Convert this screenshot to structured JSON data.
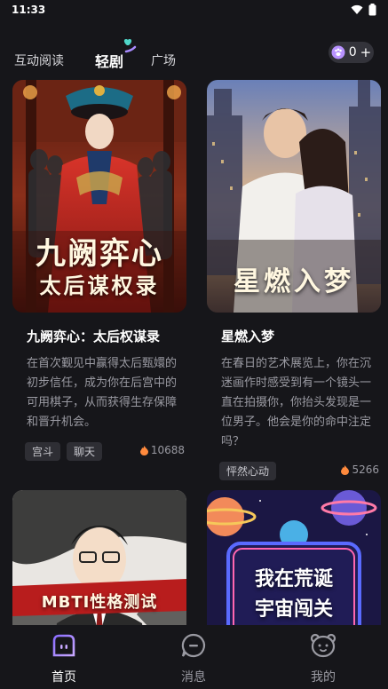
{
  "status_bar": {
    "time": "11:33"
  },
  "top_tabs": [
    {
      "label": "互动阅读",
      "active": false
    },
    {
      "label": "轻剧",
      "active": true
    },
    {
      "label": "广场",
      "active": false
    }
  ],
  "coins": {
    "count": "0",
    "plus": "+"
  },
  "cards": [
    {
      "cover_title_line1": "九阙弈心",
      "cover_title_line2": "太后谋权录",
      "title": "九阙弈心：太后权谋录",
      "description": "在首次觐见中赢得太后甄嬛的初步信任，成为你在后宫中的可用棋子，从而获得生存保障和晋升机会。",
      "tags": [
        "宫斗",
        "聊天"
      ],
      "heat": "10688"
    },
    {
      "cover_title_line1": "星燃入梦",
      "title": "星燃入梦",
      "description": "在春日的艺术展览上，你在沉迷画作时感受到有一个镜头一直在拍摄你，你抬头发现是一位男子。他会是你的命中注定吗？",
      "tags": [
        "怦然心动"
      ],
      "heat": "5266"
    },
    {
      "cover_title_line1": "MBTI性格测试"
    },
    {
      "cover_title_line1": "我在荒诞",
      "cover_title_line2": "宇宙闯关"
    }
  ],
  "bottom_nav": [
    {
      "label": "首页",
      "active": true
    },
    {
      "label": "消息",
      "active": false
    },
    {
      "label": "我的",
      "active": false
    }
  ],
  "colors": {
    "accent": "#a98bff",
    "background": "#16161a",
    "chip": "#2e2e34",
    "flame": "#ff8a3d"
  }
}
